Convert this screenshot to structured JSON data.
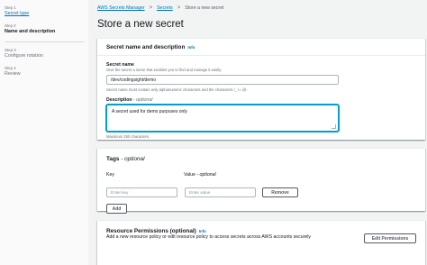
{
  "sidebar": {
    "steps": [
      {
        "num": "Step 1",
        "label": "Secret type"
      },
      {
        "num": "Step 2",
        "label": "Name and description"
      },
      {
        "num": "Step 3",
        "label": "Configure rotation"
      },
      {
        "num": "Step 4",
        "label": "Review"
      }
    ]
  },
  "breadcrumb": {
    "items": [
      "AWS Secrets Manager",
      "Secrets",
      "Store a new secret"
    ],
    "separator": ">"
  },
  "page_title": "Store a new secret",
  "name_section": {
    "title": "Secret name and description",
    "info": "Info",
    "name_label": "Secret name",
    "name_desc": "Give the secret a name that enables you to find and manage it easily.",
    "name_value": "/dev/codingsight/demo",
    "name_hint": "Secret name must contain only alphanumeric characters and the characters /_+=.@-",
    "desc_label": "Description",
    "desc_optional": "- optional",
    "desc_value": "A secret used for demo purposes only",
    "desc_hint": "Maximum 250 characters."
  },
  "tags_section": {
    "title": "Tags",
    "title_optional": "- optional",
    "key_header": "Key",
    "value_header": "Value",
    "value_optional": "- optional",
    "key_placeholder": "Enter key",
    "value_placeholder": "Enter value",
    "remove_label": "Remove",
    "add_label": "Add"
  },
  "resource_section": {
    "title": "Resource Permissions (optional)",
    "info": "Info",
    "desc": "Add a new resource policy or edit resource policy to access secrets across AWS accounts securely",
    "edit_label": "Edit Permissions"
  }
}
